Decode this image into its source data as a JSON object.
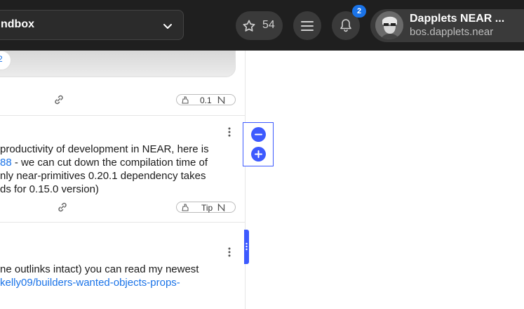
{
  "navbar": {
    "environment_label": "ndbox",
    "star_count": "54",
    "notification_count": "2",
    "account_name": "Dapplets NEAR ...",
    "account_id": "bos.dapplets.near"
  },
  "feed": {
    "image_bubble_text": "2",
    "posts": [
      {
        "tip_label": "0.1",
        "tip_icon": "near-icon"
      },
      {
        "lines": [
          "productivity of development in NEAR, here is",
          "- we can cut down the compilation time of",
          "nly near-primitives 0.20.1 dependency takes",
          "ds for 0.15.0 version)"
        ],
        "link_fragment": "88",
        "tip_label": "Tip"
      },
      {
        "lines": [
          "ne outlinks intact) you can read my newest"
        ],
        "link_line": "kelly09/builders-wanted-objects-props-"
      }
    ]
  },
  "colors": {
    "accent": "#3d5afe",
    "link": "#1a73e8",
    "navbar_bg": "#1f1f1f"
  },
  "icons": {
    "star": "star-icon",
    "menu": "hamburger-icon",
    "bell": "bell-icon",
    "chevron": "chevron-down-icon",
    "link": "link-icon",
    "tip": "tip-hand-icon",
    "kebab": "more-vertical-icon",
    "zoom_out": "minus-icon",
    "zoom_in": "plus-icon"
  }
}
